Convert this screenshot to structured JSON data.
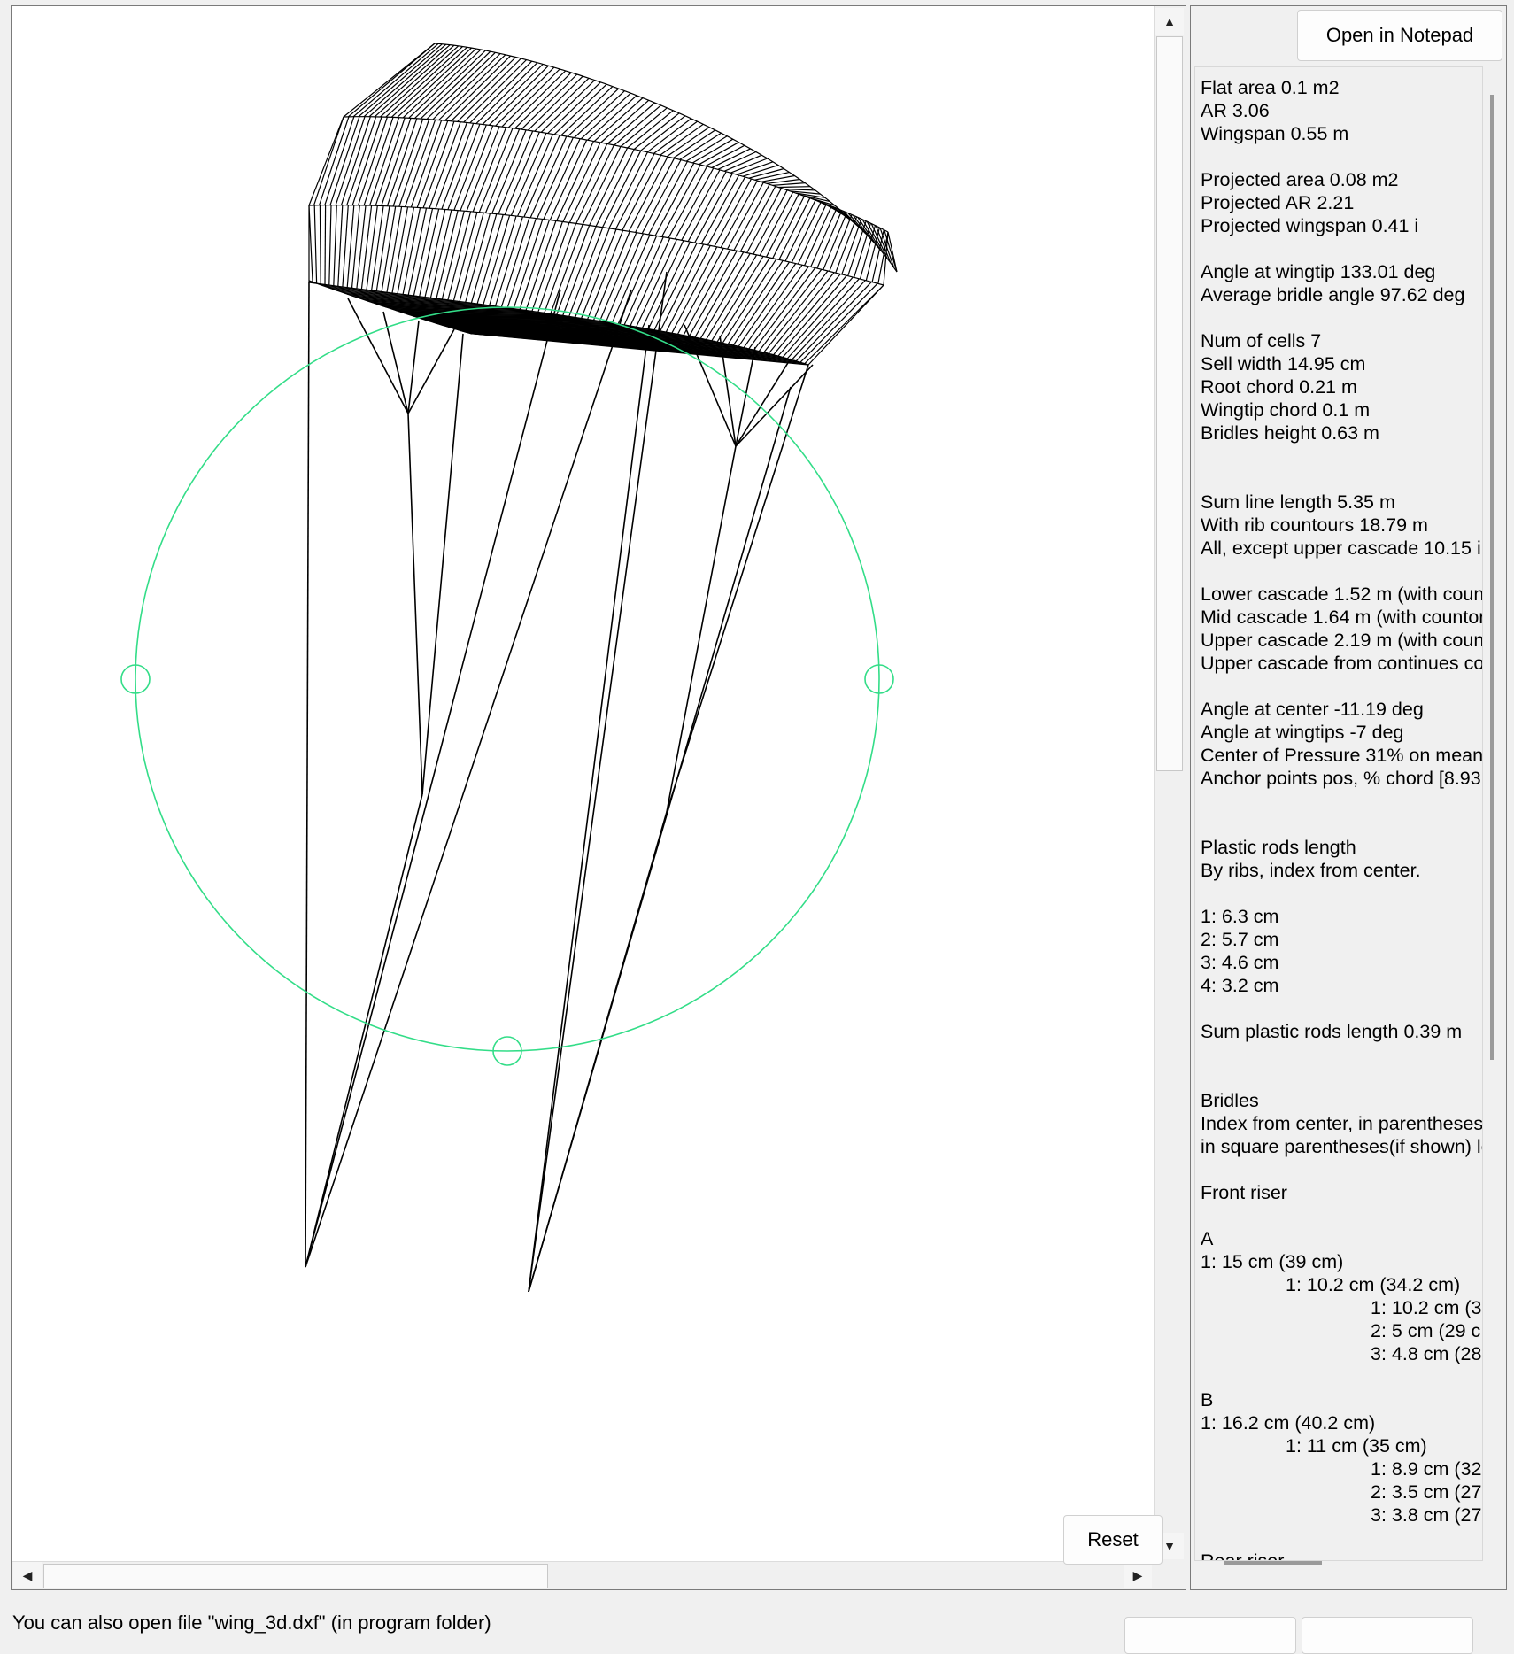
{
  "canvas": {
    "reset_label": "Reset",
    "accent_color": "#33dd88",
    "scroll_left_icon": "arrow-left-icon",
    "scroll_right_icon": "arrow-right-icon",
    "scroll_up_icon": "arrow-up-icon",
    "scroll_down_icon": "arrow-down-icon"
  },
  "info": {
    "open_notepad_label": "Open in Notepad",
    "lines": [
      {
        "text": "Flat area 0.1 m2",
        "indent": 0
      },
      {
        "text": "AR 3.06",
        "indent": 0
      },
      {
        "text": "Wingspan 0.55 m",
        "indent": 0
      },
      {
        "text": "",
        "indent": 0
      },
      {
        "text": "Projected area 0.08 m2",
        "indent": 0
      },
      {
        "text": "Projected AR 2.21",
        "indent": 0
      },
      {
        "text": "Projected wingspan 0.41 i",
        "indent": 0
      },
      {
        "text": "",
        "indent": 0
      },
      {
        "text": "Angle at wingtip 133.01 deg",
        "indent": 0
      },
      {
        "text": "Average bridle angle 97.62 deg",
        "indent": 0
      },
      {
        "text": "",
        "indent": 0
      },
      {
        "text": "Num of cells 7",
        "indent": 0
      },
      {
        "text": "Sell width 14.95 cm",
        "indent": 0
      },
      {
        "text": "Root chord 0.21 m",
        "indent": 0
      },
      {
        "text": "Wingtip chord 0.1 m",
        "indent": 0
      },
      {
        "text": "Bridles height 0.63 m",
        "indent": 0
      },
      {
        "text": "",
        "indent": 0
      },
      {
        "text": "",
        "indent": 0
      },
      {
        "text": "Sum line length 5.35 m",
        "indent": 0
      },
      {
        "text": "With rib countours 18.79 m",
        "indent": 0
      },
      {
        "text": "All, except upper cascade 10.15 i",
        "indent": 0
      },
      {
        "text": "",
        "indent": 0
      },
      {
        "text": "Lower cascade 1.52 m (with coun",
        "indent": 0
      },
      {
        "text": "Mid cascade 1.64 m (with countor",
        "indent": 0
      },
      {
        "text": "Upper cascade 2.19 m (with coun",
        "indent": 0
      },
      {
        "text": "Upper cascade from continues co",
        "indent": 0
      },
      {
        "text": "",
        "indent": 0
      },
      {
        "text": "Angle at center -11.19 deg",
        "indent": 0
      },
      {
        "text": "Angle at wingtips -7 deg",
        "indent": 0
      },
      {
        "text": "Center of Pressure 31% on mean",
        "indent": 0
      },
      {
        "text": "Anchor points pos, % chord [8.93",
        "indent": 0
      },
      {
        "text": "",
        "indent": 0
      },
      {
        "text": "",
        "indent": 0
      },
      {
        "text": "Plastic rods length",
        "indent": 0
      },
      {
        "text": "By ribs, index from center.",
        "indent": 0
      },
      {
        "text": "",
        "indent": 0
      },
      {
        "text": "1: 6.3 cm",
        "indent": 0
      },
      {
        "text": "2: 5.7 cm",
        "indent": 0
      },
      {
        "text": "3: 4.6 cm",
        "indent": 0
      },
      {
        "text": "4: 3.2 cm",
        "indent": 0
      },
      {
        "text": "",
        "indent": 0
      },
      {
        "text": "Sum plastic rods length 0.39 m",
        "indent": 0
      },
      {
        "text": "",
        "indent": 0
      },
      {
        "text": "",
        "indent": 0
      },
      {
        "text": "Bridles",
        "indent": 0
      },
      {
        "text": "Index from center, in parentheses",
        "indent": 0
      },
      {
        "text": "in square parentheses(if shown) le",
        "indent": 0
      },
      {
        "text": "",
        "indent": 0
      },
      {
        "text": "Front riser",
        "indent": 0
      },
      {
        "text": "",
        "indent": 0
      },
      {
        "text": "A",
        "indent": 0
      },
      {
        "text": "1: 15 cm (39 cm)",
        "indent": 0
      },
      {
        "text": "1: 10.2 cm (34.2 cm)",
        "indent": 1
      },
      {
        "text": "1: 10.2 cm (3",
        "indent": 2
      },
      {
        "text": "2: 5 cm (29 c",
        "indent": 2
      },
      {
        "text": "3: 4.8 cm (28",
        "indent": 2
      },
      {
        "text": "",
        "indent": 0
      },
      {
        "text": "B",
        "indent": 0
      },
      {
        "text": "1: 16.2 cm (40.2 cm)",
        "indent": 0
      },
      {
        "text": "1: 11 cm (35 cm)",
        "indent": 1
      },
      {
        "text": "1: 8.9 cm (32",
        "indent": 2
      },
      {
        "text": "2: 3.5 cm (27",
        "indent": 2
      },
      {
        "text": "3: 3.8 cm (27",
        "indent": 2
      },
      {
        "text": "",
        "indent": 0
      },
      {
        "text": "Rear riser",
        "indent": 0
      }
    ]
  },
  "status": {
    "text": "You can also open file \"wing_3d.dxf\" (in program folder)"
  }
}
